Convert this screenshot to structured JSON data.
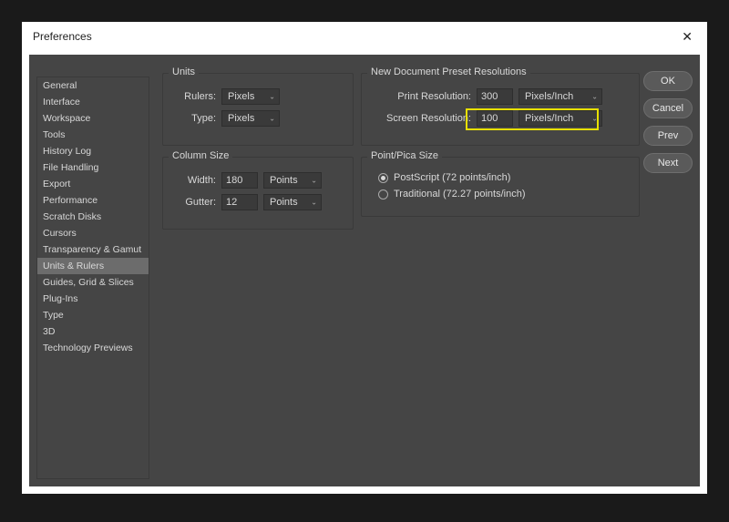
{
  "title": "Preferences",
  "sidebar": {
    "items": [
      {
        "label": "General"
      },
      {
        "label": "Interface"
      },
      {
        "label": "Workspace"
      },
      {
        "label": "Tools"
      },
      {
        "label": "History Log"
      },
      {
        "label": "File Handling"
      },
      {
        "label": "Export"
      },
      {
        "label": "Performance"
      },
      {
        "label": "Scratch Disks"
      },
      {
        "label": "Cursors"
      },
      {
        "label": "Transparency & Gamut"
      },
      {
        "label": "Units & Rulers",
        "selected": true
      },
      {
        "label": "Guides, Grid & Slices"
      },
      {
        "label": "Plug-Ins"
      },
      {
        "label": "Type"
      },
      {
        "label": "3D"
      },
      {
        "label": "Technology Previews"
      }
    ]
  },
  "units": {
    "group_title": "Units",
    "rulers_label": "Rulers:",
    "rulers_value": "Pixels",
    "type_label": "Type:",
    "type_value": "Pixels"
  },
  "column": {
    "group_title": "Column Size",
    "width_label": "Width:",
    "width_value": "180",
    "width_unit": "Points",
    "gutter_label": "Gutter:",
    "gutter_value": "12",
    "gutter_unit": "Points"
  },
  "newdoc": {
    "group_title": "New Document Preset Resolutions",
    "print_label": "Print Resolution:",
    "print_value": "300",
    "print_unit": "Pixels/Inch",
    "screen_label": "Screen Resolution:",
    "screen_value": "100",
    "screen_unit": "Pixels/Inch"
  },
  "pointpica": {
    "group_title": "Point/Pica Size",
    "postscript_label": "PostScript (72 points/inch)",
    "traditional_label": "Traditional (72.27 points/inch)",
    "selected": "postscript"
  },
  "buttons": {
    "ok": "OK",
    "cancel": "Cancel",
    "prev": "Prev",
    "next": "Next"
  }
}
